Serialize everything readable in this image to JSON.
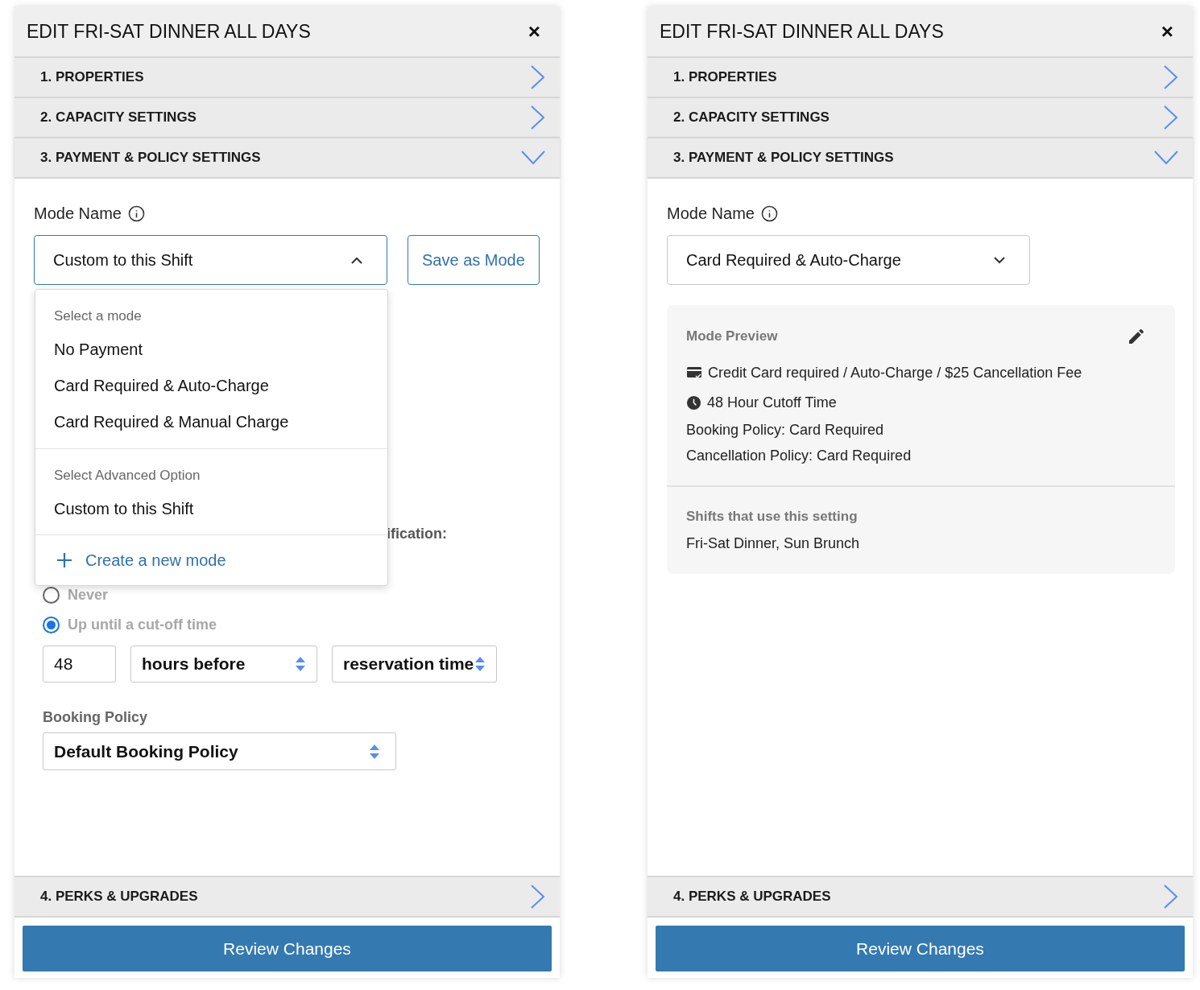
{
  "panels": [
    {
      "title": "EDIT FRI-SAT DINNER ALL DAYS",
      "close": "×",
      "sections": [
        {
          "label": "1. PROPERTIES",
          "expanded": false
        },
        {
          "label": "2. CAPACITY SETTINGS",
          "expanded": false
        },
        {
          "label": "3. PAYMENT & POLICY SETTINGS",
          "expanded": true
        }
      ],
      "mode_label": "Mode Name",
      "mode_select": {
        "value": "Custom to this Shift",
        "open": true
      },
      "save_button": "Save as Mode",
      "dropdown": {
        "groups": [
          {
            "heading": "Select a mode",
            "options": [
              "No Payment",
              "Card Required & Auto-Charge",
              "Card Required & Manual Charge"
            ]
          },
          {
            "heading": "Select Advanced Option",
            "options": [
              "Custom to this Shift"
            ]
          }
        ],
        "create": "Create a new mode"
      },
      "policy": {
        "partial_label": "ification:",
        "radios": [
          {
            "label": "Never",
            "selected": false
          },
          {
            "label": "Up until a cut-off time",
            "selected": true
          }
        ],
        "cutoff_value": "48",
        "cutoff_unit": "hours before",
        "cutoff_reference": "reservation time",
        "booking_label": "Booking Policy",
        "booking_value": "Default Booking Policy"
      },
      "bottom_section": {
        "label": "4. PERKS & UPGRADES",
        "expanded": false
      },
      "review_button": "Review Changes"
    },
    {
      "title": "EDIT FRI-SAT DINNER ALL DAYS",
      "close": "×",
      "sections": [
        {
          "label": "1. PROPERTIES",
          "expanded": false
        },
        {
          "label": "2. CAPACITY SETTINGS",
          "expanded": false
        },
        {
          "label": "3. PAYMENT & POLICY SETTINGS",
          "expanded": true
        }
      ],
      "mode_label": "Mode Name",
      "mode_select": {
        "value": "Card Required & Auto-Charge",
        "open": false
      },
      "preview": {
        "heading": "Mode Preview",
        "lines": [
          {
            "kind": "card",
            "text": "Credit Card required / Auto-Charge / $25 Cancellation Fee"
          },
          {
            "kind": "clock",
            "text": "48 Hour Cutoff Time"
          },
          {
            "kind": "plain",
            "text": "Booking Policy: Card Required"
          },
          {
            "kind": "plain",
            "text": "Cancellation Policy: Card Required"
          }
        ],
        "shifts_heading": "Shifts that use this setting",
        "shifts": "Fri-Sat Dinner, Sun Brunch"
      },
      "bottom_section": {
        "label": "4. PERKS & UPGRADES",
        "expanded": false
      },
      "review_button": "Review Changes"
    }
  ]
}
